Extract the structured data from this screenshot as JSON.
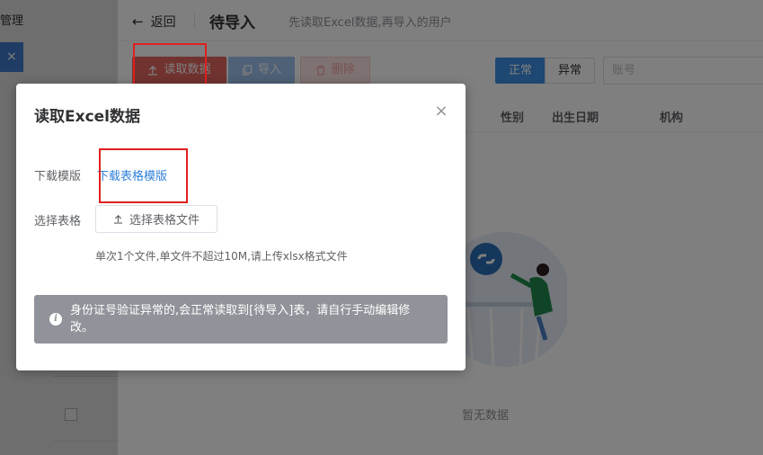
{
  "left_panel": {
    "title": "管理",
    "close_glyph": "×"
  },
  "topbar": {
    "back_arrow": "←",
    "back_label": "返回",
    "title": "待导入",
    "subtitle": "先读取Excel数据,再导入的用户"
  },
  "toolbar": {
    "read_label": "读取数据",
    "import_label": "导入",
    "delete_label": "删除",
    "status_normal": "正常",
    "status_abnormal": "异常",
    "account_placeholder": "账号"
  },
  "table": {
    "headers": [
      "性别",
      "出生日期",
      "机构"
    ],
    "empty_text": "暂无数据"
  },
  "dialog": {
    "title": "读取Excel数据",
    "close_glyph": "×",
    "template_label": "下载模版",
    "template_link": "下载表格模版",
    "file_label": "选择表格",
    "file_button": "选择表格文件",
    "hint": "单次1个文件,单文件不超过10M,请上传xlsx格式文件",
    "alert_icon": "i",
    "alert_text": "身份证号验证异常的,会正常读取到[待导入]表，请自行手动编辑修改。"
  },
  "colors": {
    "primary": "#3d8ee5",
    "danger": "#e2665f",
    "link": "#2f7fd8",
    "annotation": "#e02020",
    "alert_bg": "#909399"
  },
  "icons": [
    "back-arrow-icon",
    "upload-icon",
    "copy-icon",
    "trash-icon",
    "close-icon",
    "info-icon",
    "empty-illustration"
  ]
}
